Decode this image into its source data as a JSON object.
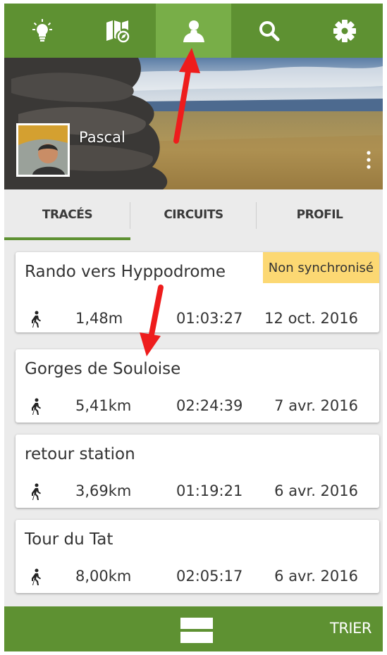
{
  "nav": {
    "items": [
      {
        "icon": "lightbulb-icon",
        "active": false
      },
      {
        "icon": "map-icon",
        "active": false
      },
      {
        "icon": "user-icon",
        "active": true
      },
      {
        "icon": "search-icon",
        "active": false
      },
      {
        "icon": "gear-icon",
        "active": false
      }
    ]
  },
  "profile": {
    "name": "Pascal"
  },
  "tabs": [
    {
      "label": "TRACÉS",
      "active": true
    },
    {
      "label": "CIRCUITS",
      "active": false
    },
    {
      "label": "PROFIL",
      "active": false
    }
  ],
  "tracks": [
    {
      "title": "Rando vers Hyppodrome",
      "badge": "Non synchronisé",
      "distance": "1,48m",
      "duration": "01:03:27",
      "date": "12 oct. 2016"
    },
    {
      "title": "Gorges de Souloise",
      "badge": "",
      "distance": "5,41km",
      "duration": "02:24:39",
      "date": "7 avr. 2016"
    },
    {
      "title": "retour station",
      "badge": "",
      "distance": "3,69km",
      "duration": "01:19:21",
      "date": "6 avr. 2016"
    },
    {
      "title": "Tour du Tat",
      "badge": "",
      "distance": "8,00km",
      "duration": "02:05:17",
      "date": "6 avr. 2016"
    }
  ],
  "bottom": {
    "sort_label": "TRIER"
  },
  "colors": {
    "primary": "#5e9132",
    "active_tab": "#78ae48",
    "badge": "#fcd873",
    "arrow": "#ee1c1c"
  }
}
